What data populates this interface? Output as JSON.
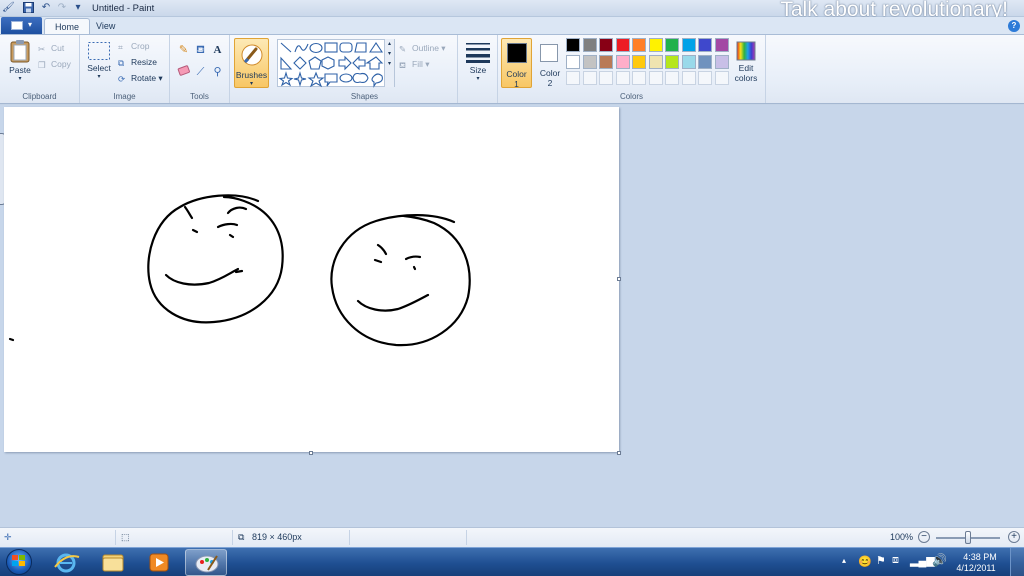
{
  "window": {
    "title": "Untitled - Paint",
    "overlay_caption": "Talk about revolutionary!"
  },
  "tabs": [
    {
      "label": "Home",
      "active": true
    },
    {
      "label": "View",
      "active": false
    }
  ],
  "ribbon": {
    "clipboard": {
      "group_label": "Clipboard",
      "paste": "Paste",
      "cut": "Cut",
      "copy": "Copy"
    },
    "image": {
      "group_label": "Image",
      "select": "Select",
      "crop": "Crop",
      "resize": "Resize",
      "rotate": "Rotate"
    },
    "tools": {
      "group_label": "Tools",
      "items": [
        "pencil-icon",
        "fill-icon",
        "text-icon",
        "eraser-icon",
        "color-picker-icon",
        "magnifier-icon"
      ]
    },
    "brushes": {
      "label": "Brushes"
    },
    "shapes": {
      "group_label": "Shapes",
      "outline": "Outline",
      "fill": "Fill"
    },
    "size": {
      "label": "Size"
    },
    "colors": {
      "group_label": "Colors",
      "color1_line1": "Color",
      "color1_line2": "1",
      "color2_line1": "Color",
      "color2_line2": "2",
      "edit_line1": "Edit",
      "edit_line2": "colors",
      "palette_row1": [
        "#000000",
        "#7f7f7f",
        "#880015",
        "#ed1c24",
        "#ff7f27",
        "#fff200",
        "#22b14c",
        "#00a2e8",
        "#3f48cc",
        "#a349a4"
      ],
      "palette_row2": [
        "#ffffff",
        "#c3c3c3",
        "#b97a57",
        "#ffaec9",
        "#ffc90e",
        "#efe4b0",
        "#b5e61d",
        "#99d9ea",
        "#7092be",
        "#c8bfe7"
      ],
      "color1": "#000000",
      "color2": "#ffffff"
    }
  },
  "canvas": {
    "background": "#ffffff"
  },
  "statusbar": {
    "canvas_size": "819 × 460px",
    "zoom": "100%"
  },
  "taskbar": {
    "pinned": [
      "internet-explorer-icon",
      "file-explorer-icon",
      "media-player-icon",
      "paint-icon"
    ],
    "time": "4:38 PM",
    "date": "4/12/2011"
  }
}
